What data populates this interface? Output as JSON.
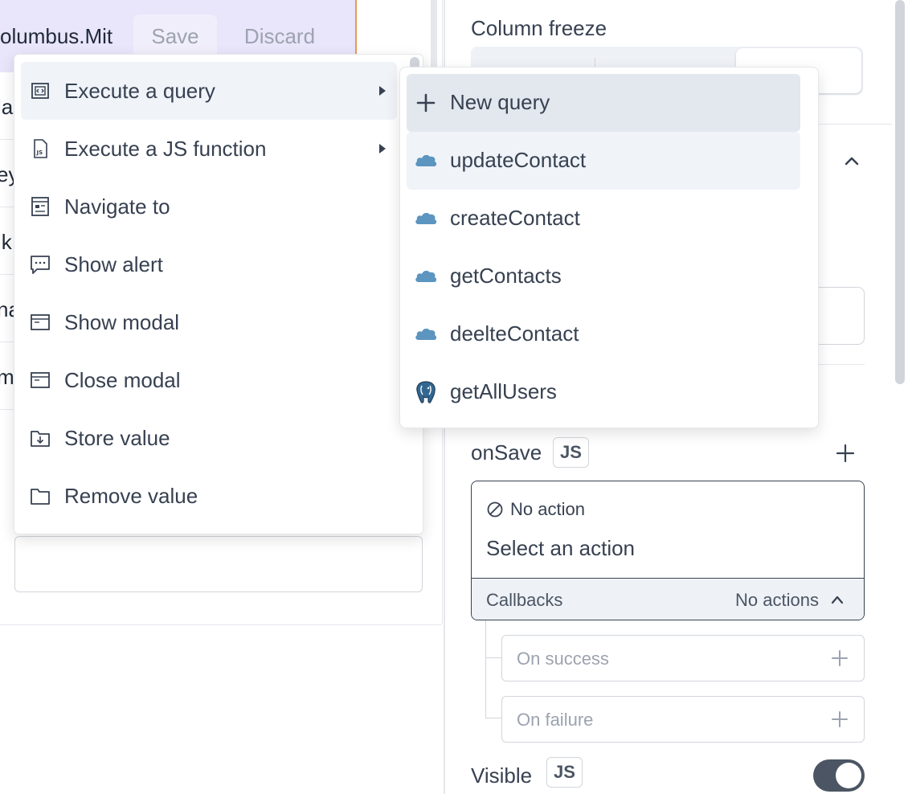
{
  "table": {
    "editing_cell_text": "olumbus.Mit",
    "save_label": "Save",
    "discard_label": "Discard",
    "row_fragments": [
      "la",
      "ey",
      "ik",
      "na",
      "m"
    ]
  },
  "action_menu": {
    "items": [
      {
        "label": "Execute a query",
        "icon": "query-icon",
        "has_submenu": true
      },
      {
        "label": "Execute a JS function",
        "icon": "js-file-icon",
        "has_submenu": true
      },
      {
        "label": "Navigate to",
        "icon": "navigate-icon"
      },
      {
        "label": "Show alert",
        "icon": "alert-message-icon"
      },
      {
        "label": "Show modal",
        "icon": "modal-window-icon"
      },
      {
        "label": "Close modal",
        "icon": "modal-window-icon"
      },
      {
        "label": "Store value",
        "icon": "store-folder-icon"
      },
      {
        "label": "Remove value",
        "icon": "folder-icon"
      }
    ]
  },
  "query_menu": {
    "new_query_label": "New query",
    "queries": [
      {
        "label": "updateContact",
        "icon": "cloud-icon"
      },
      {
        "label": "createContact",
        "icon": "cloud-icon"
      },
      {
        "label": "getContacts",
        "icon": "cloud-icon"
      },
      {
        "label": "deelteContact",
        "icon": "cloud-icon"
      },
      {
        "label": "getAllUsers",
        "icon": "postgres-elephant-icon"
      }
    ]
  },
  "property_pane": {
    "column_freeze_label": "Column freeze",
    "onsave_label": "onSave",
    "js_badge": "JS",
    "no_action_label": "No action",
    "select_action_placeholder": "Select an action",
    "callbacks_label": "Callbacks",
    "no_actions_label": "No actions",
    "on_success_label": "On success",
    "on_failure_label": "On failure",
    "visible_label": "Visible",
    "visible_enabled": true
  },
  "colors": {
    "cloud_icon": "#5b95c0",
    "header_row_bg": "#e9e5fa",
    "active_item_bg": "#f0f3f8",
    "new_query_bg": "#e3e7ee",
    "toggle_on": "#4b5563"
  }
}
